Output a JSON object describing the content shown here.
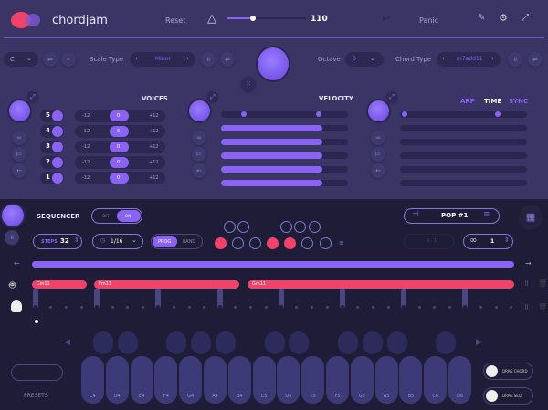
{
  "header": {
    "app_name": "chordjam",
    "reset": "Reset",
    "tempo": "110",
    "tempo_fraction": 0.33,
    "panic": "Panic"
  },
  "controls": {
    "key": "C",
    "scale_label": "Scale Type",
    "scale": "Minor",
    "octave_label": "Octave",
    "octave": "0",
    "chord_type_label": "Chord Type",
    "chord_type": "m7add11"
  },
  "voices": {
    "title": "VOICES",
    "rows": [
      {
        "n": "5",
        "min": "-12",
        "val": "0",
        "max": "+12"
      },
      {
        "n": "4",
        "min": "-12",
        "val": "0",
        "max": "+12"
      },
      {
        "n": "3",
        "min": "-12",
        "val": "0",
        "max": "+12"
      },
      {
        "n": "2",
        "min": "-12",
        "val": "0",
        "max": "+12"
      },
      {
        "n": "1",
        "min": "-12",
        "val": "0",
        "max": "+12"
      }
    ]
  },
  "velocity": {
    "title": "VELOCITY",
    "levels": [
      0.8,
      0.8,
      0.8,
      0.8,
      0.8
    ]
  },
  "arp": {
    "tabs": [
      "ARP",
      "TIME",
      "SYNC"
    ]
  },
  "sequencer": {
    "title": "SEQUENCER",
    "off": "OFF",
    "on": "ON",
    "steps_label": "STEPS",
    "steps": "32",
    "rate": "1/16",
    "prog": "PROG",
    "rand": "RAND",
    "preset": "POP #1",
    "loop_count": "1",
    "ratio": "4 : 1"
  },
  "chords": [
    {
      "name": "Cm11"
    },
    {
      "name": "Fm11"
    },
    {
      "name": "Gm11"
    }
  ],
  "rhythm_top": [
    false,
    false,
    false,
    false,
    false
  ],
  "rhythm_bottom": [
    true,
    false,
    false,
    true,
    true,
    false,
    false
  ],
  "keys": [
    "C4",
    "D4",
    "E4",
    "F4",
    "G4",
    "A4",
    "B4",
    "C5",
    "D5",
    "E5",
    "F5",
    "G5",
    "A5",
    "B5",
    "C6",
    "D6"
  ],
  "footer": {
    "presets": "PRESETS",
    "drag_chord": "DRAG CHORD",
    "drag_seq": "DRAG SEQ"
  },
  "colors": {
    "accent": "#8a63f5",
    "pink": "#f0426a"
  }
}
